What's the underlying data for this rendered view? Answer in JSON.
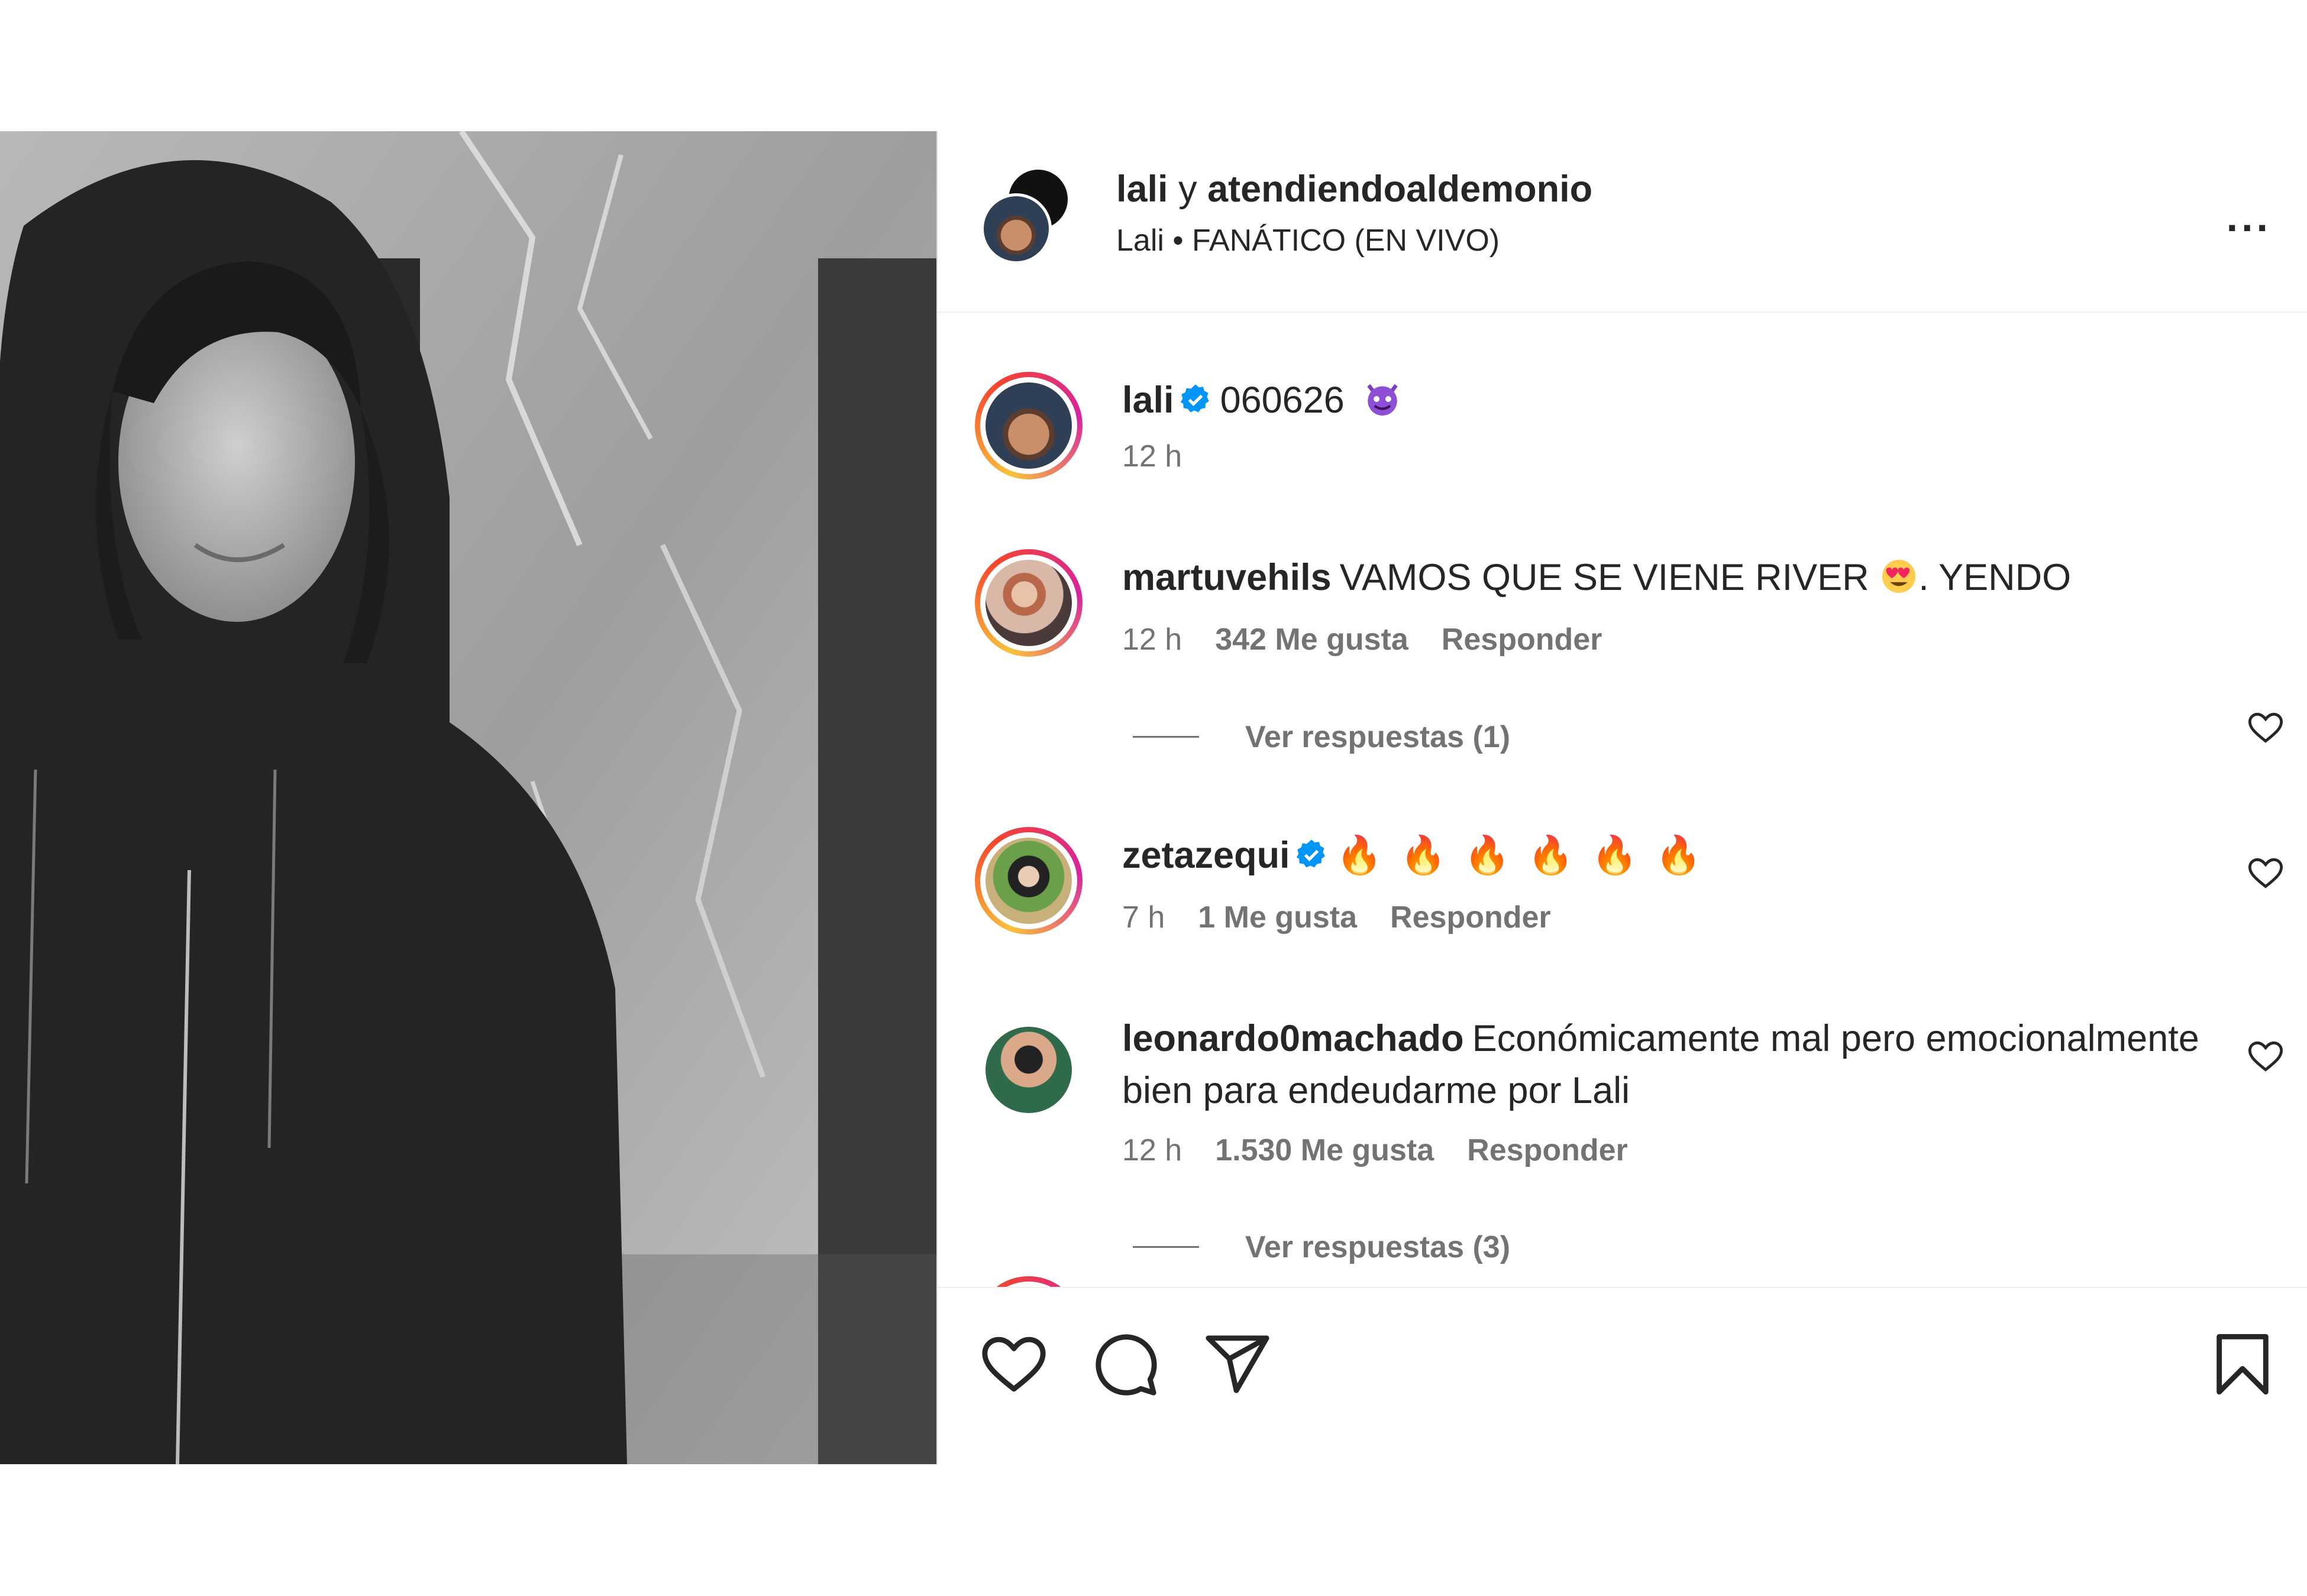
{
  "post": {
    "header": {
      "author": "lali",
      "connector": "y",
      "coauthor": "atendiendoaldemonio",
      "subtitle": "Lali • FANÁTICO (EN VIVO)",
      "more_label": "..."
    },
    "caption": {
      "user": "lali",
      "verified": true,
      "text": "060626",
      "emoji": "smiling-devil",
      "time": "12 h"
    },
    "comments": [
      {
        "user": "martuvehils",
        "verified": false,
        "text_before": "VAMOS QUE SE VIENE RIVER",
        "emoji": "heart-eyes",
        "text_after": ". YENDO",
        "time": "12 h",
        "likes": "342 Me gusta",
        "reply_label": "Responder",
        "view_replies": "Ver respuestas (1)"
      },
      {
        "user": "zetazequi",
        "verified": true,
        "text": "🔥 🔥 🔥 🔥 🔥 🔥",
        "emoji": "fire",
        "emoji_count": 6,
        "time": "7 h",
        "likes": "1 Me gusta",
        "reply_label": "Responder"
      },
      {
        "user": "leonardo0machado",
        "verified": false,
        "text": "Económicamente mal pero emocionalmente bien para endeudarme por Lali",
        "time": "12 h",
        "likes": "1.530 Me gusta",
        "reply_label": "Responder",
        "view_replies": "Ver respuestas (3)"
      }
    ]
  },
  "icons": {
    "like": "heart-icon",
    "comment": "comment-icon",
    "share": "paper-plane-icon",
    "save": "bookmark-icon",
    "verified": "verified-badge-icon"
  },
  "colors": {
    "verified_blue": "#0095f6",
    "story_ring_start": "#f9c23c",
    "story_ring_end": "#d6249f",
    "meta_gray": "#737373",
    "text": "#262626"
  }
}
